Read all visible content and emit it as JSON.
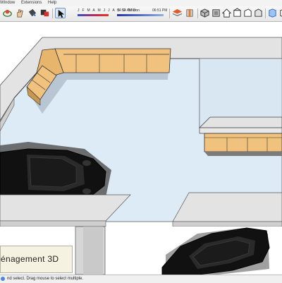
{
  "menu": [
    "Window",
    "Extensions",
    "Help"
  ],
  "toolbar": {
    "tools": [
      "orbit-icon",
      "pan-icon",
      "paint-bucket-icon",
      "component-icon",
      "select-arrow-icon",
      "layers-icon",
      "section-plane-icon",
      "iso-view-icon",
      "top-view-icon",
      "home-view-icon",
      "front-view-icon",
      "right-view-icon",
      "back-view-icon",
      "left-view-icon",
      "xray-icon",
      "wireframe-icon"
    ],
    "shadow": {
      "months": "J F M A M J J A S O N D",
      "time_start": "04:54 AM",
      "time_mid": "Noon",
      "time_end": "06:51 PM",
      "month_position": 0.92,
      "time_position": 0.32
    }
  },
  "label": {
    "text": "énagement 3D"
  },
  "status": {
    "text": "nd select. Drag mouse to select multiple."
  },
  "colors": {
    "floor": "#dcebf6",
    "wall": "#e3e3e3",
    "cabinet": "#f0c27d",
    "shadow": "#575757",
    "car": "#111111",
    "accent": "#4f84d9"
  }
}
